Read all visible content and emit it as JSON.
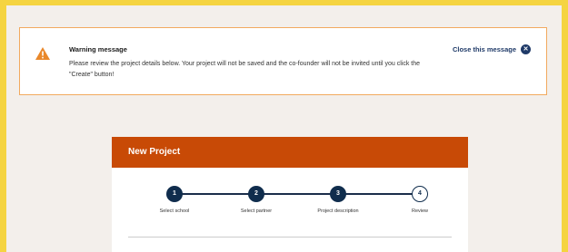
{
  "warning": {
    "title": "Warning message",
    "body": "Please review the project details below. Your project will not be saved and the co-founder will not be invited until you click the \"Create\" button!",
    "close_label": "Close this message",
    "icon": "warning-triangle-icon",
    "accent_color": "#f2a95e"
  },
  "project": {
    "header": "New Project",
    "header_color": "#c84a06",
    "steps": [
      {
        "number": "1",
        "label": "Select school",
        "state": "complete"
      },
      {
        "number": "2",
        "label": "Select partner",
        "state": "complete"
      },
      {
        "number": "3",
        "label": "Project description",
        "state": "complete"
      },
      {
        "number": "4",
        "label": "Review",
        "state": "current"
      }
    ]
  }
}
